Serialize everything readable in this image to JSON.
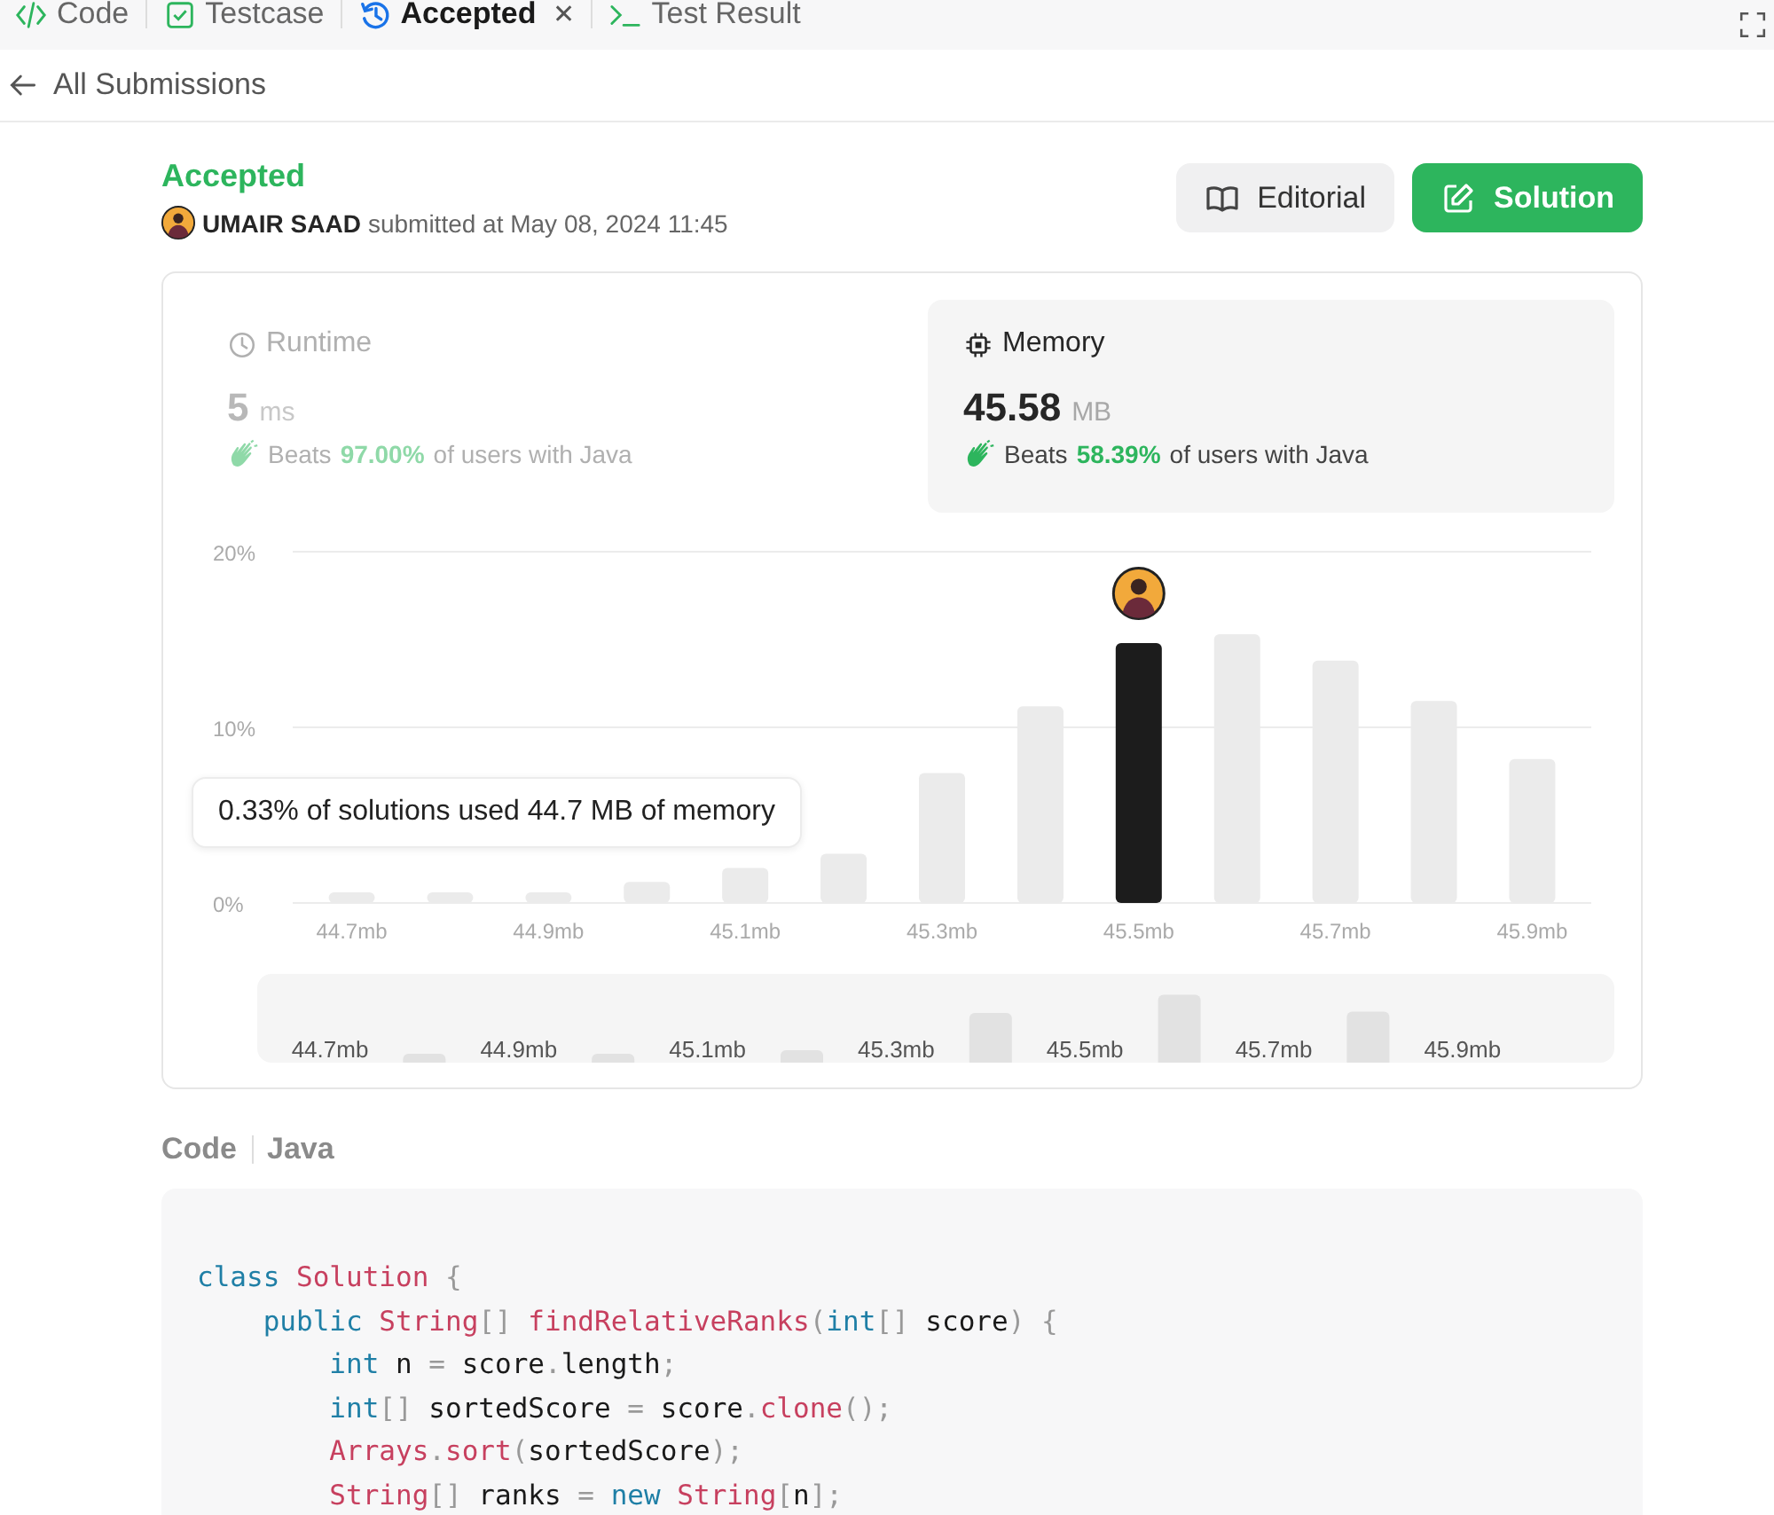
{
  "tabs": [
    {
      "label": "Code",
      "selected": false,
      "closable": false
    },
    {
      "label": "Testcase",
      "selected": false,
      "closable": false
    },
    {
      "label": "Accepted",
      "selected": true,
      "closable": true
    },
    {
      "label": "Test Result",
      "selected": false,
      "closable": false
    }
  ],
  "close_glyph": "✕",
  "back_link": "All Submissions",
  "submission": {
    "status": "Accepted",
    "user": "UMAIR SAAD",
    "submitted": "submitted at May 08, 2024 11:45"
  },
  "buttons": [
    {
      "label": "Editorial",
      "kind": "secondary"
    },
    {
      "label": "Solution",
      "kind": "primary"
    }
  ],
  "stats": [
    {
      "title": "Runtime",
      "value": "5",
      "unit": "ms",
      "beats_prefix": "Beats",
      "beats": "97.00%",
      "beats_suffix": "of users with Java",
      "selected": false
    },
    {
      "title": "Memory",
      "value": "45.58",
      "unit": "MB",
      "beats_prefix": "Beats",
      "beats": "58.39%",
      "beats_suffix": "of users with Java",
      "selected": true
    }
  ],
  "chart": {
    "chart_data": {
      "type": "bar",
      "x": [
        44.7,
        44.8,
        44.9,
        45.0,
        45.1,
        45.2,
        45.3,
        45.4,
        45.5,
        45.6,
        45.7,
        45.8,
        45.9
      ],
      "series": [
        {
          "color": "#ebebeb",
          "values": [
            0.6,
            0.6,
            0.6,
            1.2,
            2.0,
            2.8,
            7.4,
            11.2,
            null,
            15.3,
            13.8,
            11.5,
            8.2
          ]
        },
        {
          "color": "#1c1c1c",
          "values": [
            null,
            null,
            null,
            null,
            null,
            null,
            null,
            null,
            14.8,
            null,
            null,
            null,
            null
          ]
        }
      ],
      "xlim": [
        44.64,
        45.96
      ],
      "xticks": [
        {
          "value": 44.7,
          "label": "44.7mb"
        },
        {
          "value": 44.9,
          "label": "44.9mb"
        },
        {
          "value": 45.1,
          "label": "45.1mb"
        },
        {
          "value": 45.3,
          "label": "45.3mb"
        },
        {
          "value": 45.5,
          "label": "45.5mb"
        },
        {
          "value": 45.7,
          "label": "45.7mb"
        },
        {
          "value": 45.9,
          "label": "45.9mb"
        }
      ],
      "yticks": [
        {
          "value": 0,
          "label": "0%"
        },
        {
          "value": 10,
          "label": "10%"
        },
        {
          "value": 20,
          "label": "20%"
        }
      ],
      "ylim": [
        0,
        20
      ]
    },
    "tooltip": "0.33% of solutions used 44.7 MB of memory",
    "overview_labels": [
      "44.7mb",
      "44.9mb",
      "45.1mb",
      "45.3mb",
      "45.5mb",
      "45.7mb",
      "45.9mb"
    ]
  },
  "code_section": {
    "title": "Code",
    "language": "Java",
    "lines": [
      [
        {
          "kind": "kw",
          "t": "class"
        },
        {
          "kind": "ty",
          "t": " Solution"
        },
        {
          "kind": "pu",
          "t": " {"
        }
      ],
      [
        {
          "kind": "kw",
          "t": "    public"
        },
        {
          "kind": "ty",
          "t": " String"
        },
        {
          "kind": "pu",
          "t": "[]"
        },
        {
          "kind": "ty",
          "t": " findRelativeRanks"
        },
        {
          "kind": "pu",
          "t": "("
        },
        {
          "kind": "kw",
          "t": "int"
        },
        {
          "kind": "pu",
          "t": "[]"
        },
        {
          "kind": "id",
          "t": " score"
        },
        {
          "kind": "pu",
          "t": ") {"
        }
      ],
      [
        {
          "kind": "kw",
          "t": "        int"
        },
        {
          "kind": "id",
          "t": " n "
        },
        {
          "kind": "pu",
          "t": "="
        },
        {
          "kind": "id",
          "t": " score"
        },
        {
          "kind": "pu",
          "t": "."
        },
        {
          "kind": "id",
          "t": "length"
        },
        {
          "kind": "pu",
          "t": ";"
        }
      ],
      [
        {
          "kind": "kw",
          "t": "        int"
        },
        {
          "kind": "pu",
          "t": "[]"
        },
        {
          "kind": "id",
          "t": " sortedScore "
        },
        {
          "kind": "pu",
          "t": "="
        },
        {
          "kind": "id",
          "t": " score"
        },
        {
          "kind": "pu",
          "t": "."
        },
        {
          "kind": "ty",
          "t": "clone"
        },
        {
          "kind": "pu",
          "t": "();"
        }
      ],
      [
        {
          "kind": "ty",
          "t": "        Arrays"
        },
        {
          "kind": "pu",
          "t": "."
        },
        {
          "kind": "ty",
          "t": "sort"
        },
        {
          "kind": "pu",
          "t": "("
        },
        {
          "kind": "id",
          "t": "sortedScore"
        },
        {
          "kind": "pu",
          "t": ");"
        }
      ],
      [
        {
          "kind": "ty",
          "t": "        String"
        },
        {
          "kind": "pu",
          "t": "[]"
        },
        {
          "kind": "id",
          "t": " ranks "
        },
        {
          "kind": "pu",
          "t": "="
        },
        {
          "kind": "kw",
          "t": " new"
        },
        {
          "kind": "ty",
          "t": " String"
        },
        {
          "kind": "pu",
          "t": "["
        },
        {
          "kind": "id",
          "t": "n"
        },
        {
          "kind": "pu",
          "t": "];"
        }
      ]
    ]
  }
}
